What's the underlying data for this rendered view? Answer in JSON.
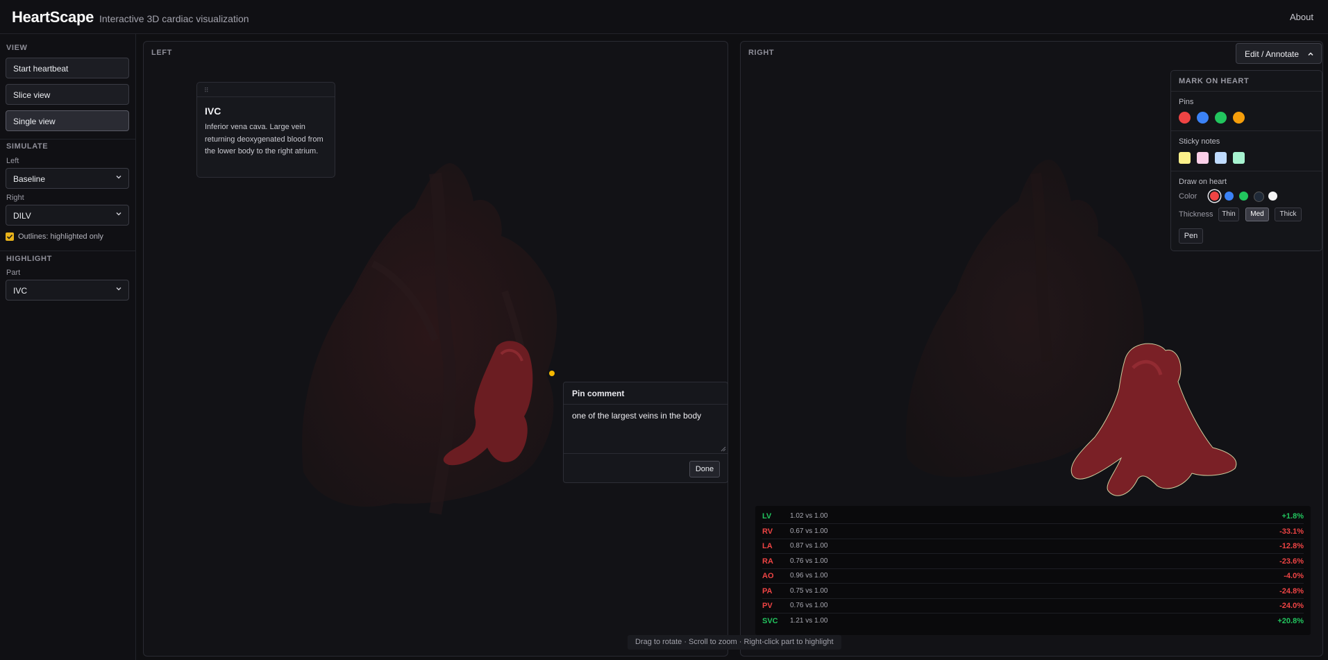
{
  "app": {
    "title": "HeartScape",
    "tagline": "Interactive 3D cardiac visualization",
    "about_label": "About"
  },
  "sidebar": {
    "view_title": "VIEW",
    "start_heartbeat": "Start heartbeat",
    "slice_view": "Slice view",
    "single_view": "Single view",
    "simulate_title": "SIMULATE",
    "left_label": "Left",
    "left_value": "Baseline",
    "right_label": "Right",
    "right_value": "DILV",
    "outlines_label": "Outlines: highlighted only",
    "outlines_checked": true,
    "highlight_title": "HIGHLIGHT",
    "part_label": "Part",
    "part_value": "IVC"
  },
  "left_panel": {
    "title": "LEFT",
    "info_card": {
      "handle": "⠿",
      "title": "IVC",
      "body": "Inferior vena cava. Large vein returning deoxygenated blood from the lower body to the right atrium."
    },
    "pin_comment": {
      "title": "Pin comment",
      "text": "one of the largest veins in the body",
      "done_label": "Done"
    }
  },
  "right_panel": {
    "title": "RIGHT",
    "edit_label": "Edit / Annotate",
    "annotate": {
      "title": "MARK ON HEART",
      "pins_label": "Pins",
      "pin_colors": [
        "#ef4444",
        "#3b82f6",
        "#22c55e",
        "#f59e0b"
      ],
      "sticky_label": "Sticky notes",
      "sticky_colors": [
        "#fdf08a",
        "#fbcfe8",
        "#bfdbfe",
        "#a7f3d0"
      ],
      "draw_label": "Draw on heart",
      "color_label": "Color",
      "draw_colors": [
        "#ef4444",
        "#3b82f6",
        "#22c55e",
        "#1f2937",
        "#f5f5f5"
      ],
      "thickness_label": "Thickness",
      "thin_label": "Thin",
      "med_label": "Med",
      "thick_label": "Thick",
      "pen_label": "Pen"
    },
    "stats": [
      {
        "key": "LV",
        "value": "1.02 vs 1.00",
        "pct": "+1.8%",
        "status": "pos"
      },
      {
        "key": "RV",
        "value": "0.67 vs 1.00",
        "pct": "-33.1%",
        "status": "neg"
      },
      {
        "key": "LA",
        "value": "0.87 vs 1.00",
        "pct": "-12.8%",
        "status": "neg"
      },
      {
        "key": "RA",
        "value": "0.76 vs 1.00",
        "pct": "-23.6%",
        "status": "neg"
      },
      {
        "key": "AO",
        "value": "0.96 vs 1.00",
        "pct": "-4.0%",
        "status": "neg"
      },
      {
        "key": "PA",
        "value": "0.75 vs 1.00",
        "pct": "-24.8%",
        "status": "neg"
      },
      {
        "key": "PV",
        "value": "0.76 vs 1.00",
        "pct": "-24.0%",
        "status": "neg"
      },
      {
        "key": "SVC",
        "value": "1.21 vs 1.00",
        "pct": "+20.8%",
        "status": "pos"
      }
    ]
  },
  "hint": "Drag to rotate · Scroll to zoom · Right-click part to highlight",
  "colors": {
    "positive": "#22c55e",
    "negative": "#ef4444",
    "accent": "#e8b21a"
  }
}
